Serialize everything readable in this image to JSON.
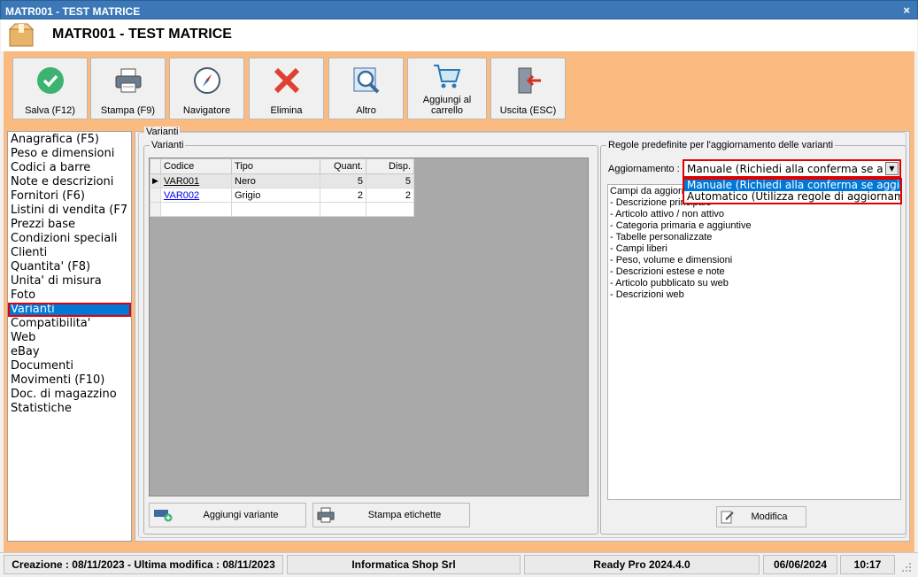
{
  "window": {
    "title": "MATR001 - TEST MATRICE",
    "close_glyph": "×"
  },
  "header": {
    "title": "MATR001 - TEST MATRICE",
    "icon": "package-box-icon"
  },
  "toolbar": {
    "save": "Salva (F12)",
    "print": "Stampa (F9)",
    "navigator": "Navigatore",
    "delete": "Elimina",
    "other": "Altro",
    "add_to_cart": "Aggiungi al carrello",
    "exit": "Uscita (ESC)"
  },
  "sidebar": {
    "items": [
      "Anagrafica (F5)",
      "Peso e dimensioni",
      "Codici a barre",
      "Note e descrizioni",
      "Fornitori (F6)",
      "Listini di vendita (F7",
      "Prezzi base",
      "Condizioni speciali",
      "Clienti",
      "Quantita' (F8)",
      "Unita' di misura",
      "Foto",
      "Varianti",
      "Compatibilita'",
      "Web",
      "eBay",
      "Documenti",
      "Movimenti (F10)",
      "Doc. di magazzino",
      "Statistiche"
    ],
    "selected": "Varianti"
  },
  "main": {
    "outer_legend": "Varianti",
    "variants_group": {
      "legend": "Varianti",
      "columns": [
        "Codice",
        "Tipo",
        "Quant.",
        "Disp."
      ],
      "rows": [
        {
          "code": "VAR001",
          "type": "Nero",
          "qty": "5",
          "avail": "5"
        },
        {
          "code": "VAR002",
          "type": "Grigio",
          "qty": "2",
          "avail": "2"
        }
      ],
      "add_button": "Aggiungi variante",
      "print_labels_button": "Stampa etichette"
    },
    "rules_group": {
      "legend": "Regole predefinite per l'aggiornamento delle varianti",
      "update_label": "Aggiornamento :",
      "update_value": "Manuale (Richiedi alla conferma se aggiornare)",
      "options": [
        "Manuale (Richiedi alla conferma se aggiornare)",
        "Automatico (Utilizza regole di aggiornamento)"
      ],
      "fields": [
        "Campi da aggiornare",
        "- Descrizione principale",
        "- Articolo attivo / non attivo",
        "- Categoria primaria e aggiuntive",
        "- Tabelle personalizzate",
        "- Campi liberi",
        "- Peso, volume e dimensioni",
        "- Descrizioni estese e note",
        "- Articolo pubblicato su web",
        "- Descrizioni web"
      ],
      "modify_button": "Modifica"
    }
  },
  "statusbar": {
    "created": "Creazione : 08/11/2023 - Ultima modifica : 08/11/2023",
    "company": "Informatica Shop Srl",
    "version": "Ready Pro 2024.4.0",
    "date": "06/06/2024",
    "time": "10:17"
  },
  "colors": {
    "titlebar": "#3c78b8",
    "workspace": "#fbbb80",
    "selection": "#0078d7",
    "highlight": "#e00000"
  }
}
